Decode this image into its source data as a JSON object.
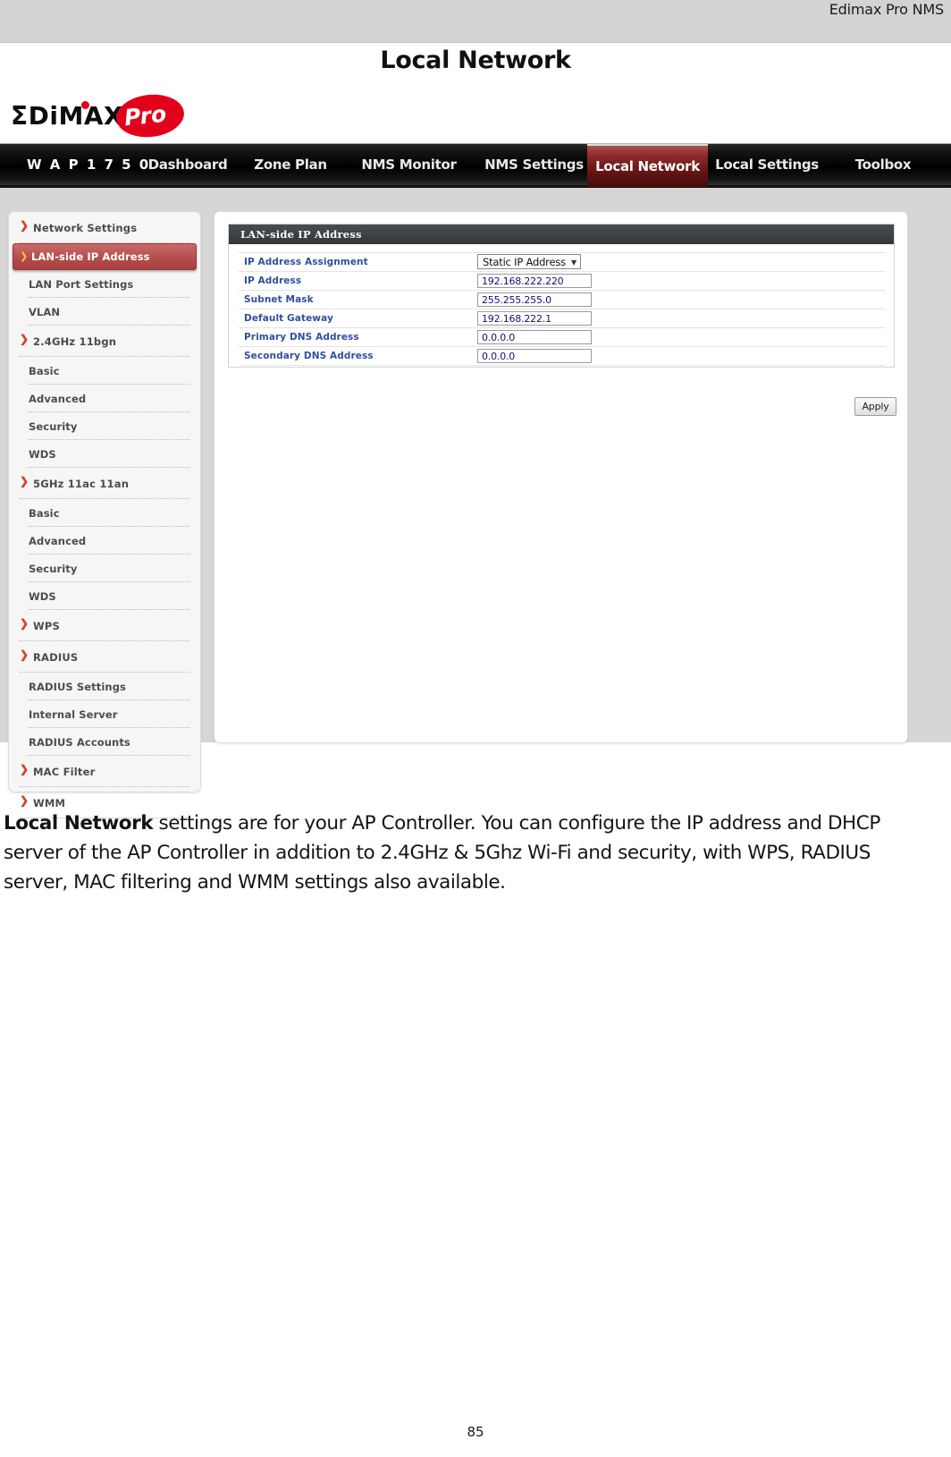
{
  "document": {
    "header_text": "Edimax Pro NMS",
    "page_title": "Local Network",
    "page_number": "85"
  },
  "logo": {
    "brand": "ΣDiMAX",
    "suffix": "Pro",
    "accent_color": "#e3001b"
  },
  "navbar": {
    "items": [
      {
        "label": "W A P 1 7 5 0",
        "active": false,
        "brand": true
      },
      {
        "label": "Dashboard",
        "active": false
      },
      {
        "label": "Zone Plan",
        "active": false
      },
      {
        "label": "NMS Monitor",
        "active": false
      },
      {
        "label": "NMS Settings",
        "active": false
      },
      {
        "label": "Local Network",
        "active": true
      },
      {
        "label": "Local Settings",
        "active": false
      },
      {
        "label": "Toolbox",
        "active": false
      }
    ],
    "active_color": "#7a2020"
  },
  "sidebar": {
    "groups": [
      {
        "label": "Network Settings",
        "items": [
          {
            "label": "LAN-side IP Address",
            "active": true
          },
          {
            "label": "LAN Port Settings",
            "active": false
          },
          {
            "label": "VLAN",
            "active": false
          }
        ]
      },
      {
        "label": "2.4GHz 11bgn",
        "items": [
          {
            "label": "Basic",
            "active": false
          },
          {
            "label": "Advanced",
            "active": false
          },
          {
            "label": "Security",
            "active": false
          },
          {
            "label": "WDS",
            "active": false
          }
        ]
      },
      {
        "label": "5GHz 11ac 11an",
        "items": [
          {
            "label": "Basic",
            "active": false
          },
          {
            "label": "Advanced",
            "active": false
          },
          {
            "label": "Security",
            "active": false
          },
          {
            "label": "WDS",
            "active": false
          }
        ]
      },
      {
        "label": "WPS",
        "items": []
      },
      {
        "label": "RADIUS",
        "items": [
          {
            "label": "RADIUS Settings",
            "active": false
          },
          {
            "label": "Internal Server",
            "active": false
          },
          {
            "label": "RADIUS Accounts",
            "active": false
          }
        ]
      },
      {
        "label": "MAC Filter",
        "items": []
      },
      {
        "label": "WMM",
        "items": []
      }
    ],
    "arrow_glyph": "❯",
    "active_color": "#b84f4f"
  },
  "panel": {
    "title": "LAN-side IP Address",
    "fields": [
      {
        "label": "IP Address Assignment",
        "type": "select",
        "value": "Static IP Address"
      },
      {
        "label": "IP Address",
        "type": "text",
        "value": "192.168.222.220"
      },
      {
        "label": "Subnet Mask",
        "type": "text",
        "value": "255.255.255.0"
      },
      {
        "label": "Default Gateway",
        "type": "text",
        "value": "192.168.222.1"
      },
      {
        "label": "Primary DNS Address",
        "type": "text",
        "value": "0.0.0.0"
      },
      {
        "label": "Secondary DNS Address",
        "type": "text",
        "value": "0.0.0.0"
      }
    ],
    "apply_label": "Apply"
  },
  "body": {
    "lead": "Local Network",
    "text": " settings are for your AP Controller. You can configure the IP address and DHCP server of the AP Controller in addition to 2.4GHz & 5Ghz Wi-Fi and security, with WPS, RADIUS server, MAC filtering and WMM settings also available."
  }
}
